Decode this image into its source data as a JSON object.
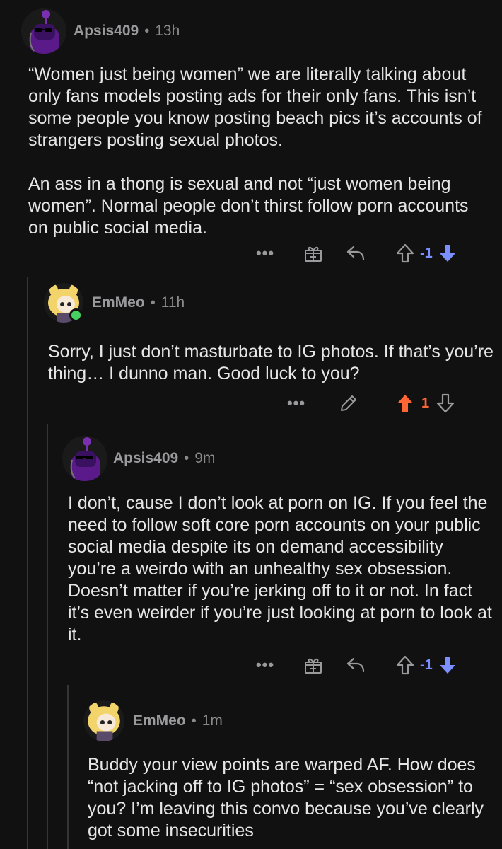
{
  "comments": [
    {
      "author": "Apsis409",
      "separator": "•",
      "time": "13h",
      "paragraphs": [
        "“Women just being women” we are literally talking about only fans models posting ads for their only fans. This isn’t some people you know posting beach pics it’s accounts of strangers posting sexual photos.",
        "An ass in a thong is sexual and not “just women being women”. Normal people don’t thirst follow porn accounts on public social media."
      ],
      "more": "•••",
      "score": "-1",
      "vote_state": "downvoted"
    },
    {
      "author": "EmMeo",
      "separator": "•",
      "time": "11h",
      "paragraphs": [
        "Sorry, I just don’t masturbate to IG photos. If that’s you’re thing… I dunno man. Good luck to you?"
      ],
      "more": "•••",
      "score": "1",
      "vote_state": "upvoted",
      "online": true
    },
    {
      "author": "Apsis409",
      "separator": "•",
      "time": "9m",
      "paragraphs": [
        "I don’t, cause I don’t look at porn on IG. If you feel the need to follow soft core porn accounts on your public social media despite its on demand accessibility you’re a weirdo with an unhealthy sex obsession. Doesn’t matter if you’re jerking off to it or not. In fact it’s even weirder if you’re just looking at porn to look at it."
      ],
      "more": "•••",
      "score": "-1",
      "vote_state": "downvoted"
    },
    {
      "author": "EmMeo",
      "separator": "•",
      "time": "1m",
      "paragraphs": [
        "Buddy your view points are warped AF. How does “not jacking off to IG photos” = “sex obsession” to you? I’m leaving this convo because you’ve clearly got some insecurities"
      ]
    }
  ],
  "colors": {
    "background": "#111112",
    "downvote_blue": "#7b8fff",
    "upvote_orange": "#ff6633",
    "online_green": "#46d160"
  },
  "icons": {
    "more": "more-options-icon",
    "award": "award-gift-icon",
    "reply": "reply-arrow-icon",
    "edit": "pencil-edit-icon",
    "upvote": "upvote-arrow-icon",
    "downvote": "downvote-arrow-icon"
  }
}
